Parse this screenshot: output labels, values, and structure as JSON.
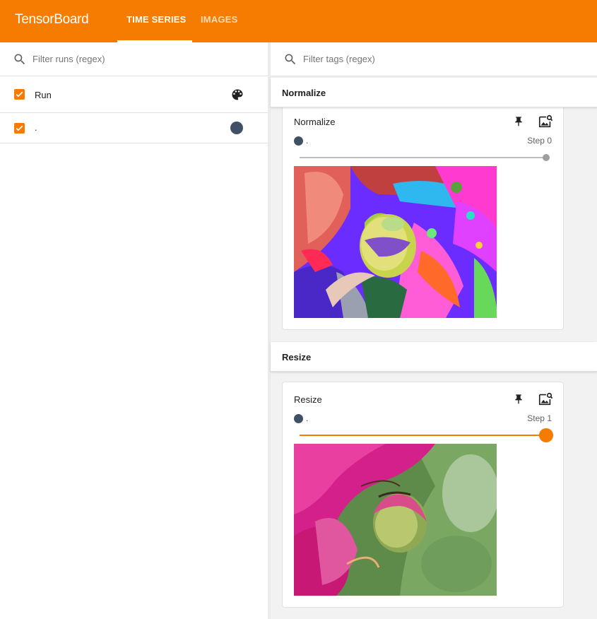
{
  "app": {
    "brand": "TensorBoard"
  },
  "tabs": [
    {
      "label": "TIME SERIES",
      "active": true
    },
    {
      "label": "IMAGES",
      "active": false
    }
  ],
  "runs": {
    "filter_placeholder": "Filter runs (regex)",
    "header_label": "Run",
    "items": [
      {
        "label": ".",
        "checked": true,
        "color": "#425066"
      }
    ]
  },
  "tags": {
    "filter_placeholder": "Filter tags (regex)"
  },
  "groups": [
    {
      "title": "Normalize",
      "card": {
        "title": "Normalize",
        "run": ".",
        "step_label": "Step 0",
        "slider_fraction": 1.0
      }
    },
    {
      "title": "Resize",
      "card": {
        "title": "Resize",
        "run": ".",
        "step_label": "Step 1",
        "slider_fraction": 1.0
      }
    }
  ],
  "colors": {
    "accent": "#f57c00",
    "run": "#425066"
  },
  "icons": [
    "search-icon",
    "palette-icon",
    "pin-icon",
    "fullsize-icon",
    "checkbox-icon"
  ]
}
